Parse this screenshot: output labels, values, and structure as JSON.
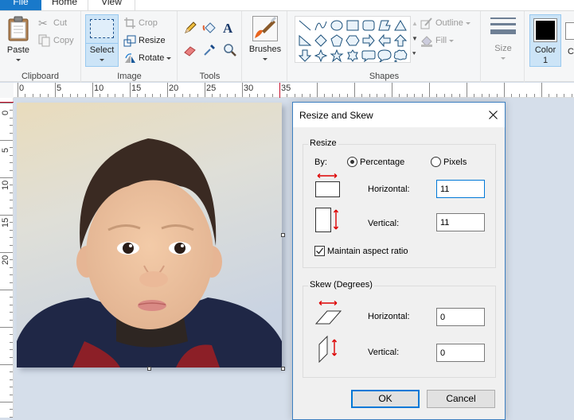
{
  "tabs": [
    {
      "label": "File",
      "active": false
    },
    {
      "label": "Home",
      "active": true
    },
    {
      "label": "View",
      "active": false
    }
  ],
  "ribbon": {
    "clipboard": {
      "group_label": "Clipboard",
      "paste_label": "Paste",
      "cut_label": "Cut",
      "copy_label": "Copy"
    },
    "image": {
      "group_label": "Image",
      "select_label": "Select",
      "crop_label": "Crop",
      "resize_label": "Resize",
      "rotate_label": "Rotate"
    },
    "tools": {
      "group_label": "Tools",
      "items": [
        "pencil-icon",
        "fill-bucket-icon",
        "text-icon",
        "eraser-icon",
        "color-picker-icon",
        "magnifier-icon"
      ]
    },
    "brushes": {
      "label": "Brushes"
    },
    "shapes": {
      "group_label": "Shapes",
      "outline_label": "Outline",
      "fill_label": "Fill",
      "gallery": [
        "line",
        "curve",
        "oval",
        "rectangle",
        "rounded-rectangle",
        "polygon",
        "triangle",
        "right-triangle",
        "diamond",
        "pentagon",
        "hexagon",
        "right-arrow",
        "left-arrow",
        "up-arrow",
        "down-arrow",
        "four-point-star",
        "five-point-star",
        "six-point-star",
        "rounded-callout",
        "oval-callout",
        "cloud-callout"
      ]
    },
    "size": {
      "label": "Size"
    },
    "colors": {
      "color1_label": "Color",
      "color1_sub": "1",
      "color1_value": "#000000",
      "color2_label_partial": "C"
    }
  },
  "ruler": {
    "horizontal_labels": [
      "0",
      "5",
      "10",
      "15",
      "20",
      "25",
      "30",
      "35"
    ],
    "vertical_labels": [
      "0",
      "5",
      "10",
      "15",
      "20"
    ],
    "marker_color": "#c8102e"
  },
  "dialog": {
    "title": "Resize and Skew",
    "resize": {
      "title": "Resize",
      "by_label": "By:",
      "options": [
        {
          "label": "Percentage",
          "checked": true
        },
        {
          "label": "Pixels",
          "checked": false
        }
      ],
      "horizontal_label": "Horizontal:",
      "horizontal_value": "11",
      "vertical_label": "Vertical:",
      "vertical_value": "11",
      "maintain_label": "Maintain aspect ratio",
      "maintain_checked": true
    },
    "skew": {
      "title": "Skew (Degrees)",
      "horizontal_label": "Horizontal:",
      "horizontal_value": "0",
      "vertical_label": "Vertical:",
      "vertical_value": "0"
    },
    "ok_label": "OK",
    "cancel_label": "Cancel"
  }
}
